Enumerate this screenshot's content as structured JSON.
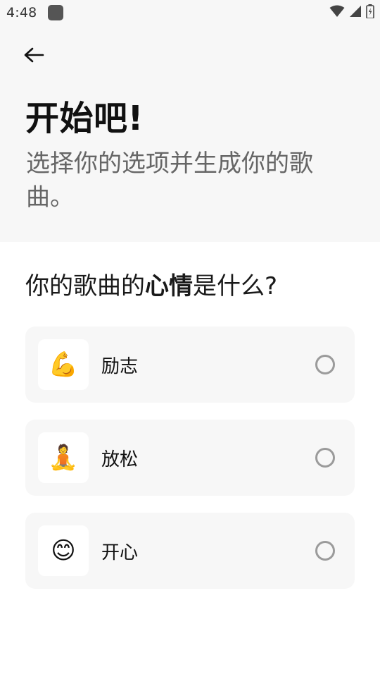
{
  "status_bar": {
    "time": "4:48",
    "icons": [
      "app-icon",
      "wifi-icon",
      "signal-icon",
      "battery-icon"
    ]
  },
  "header": {
    "back_icon": "arrow-left-icon",
    "title": "开始吧!",
    "subtitle": "选择你的选项并生成你的歌曲。"
  },
  "question": {
    "prefix": "你的歌曲的",
    "emphasis": "心情",
    "suffix": "是什么?"
  },
  "options": [
    {
      "emoji": "💪",
      "icon": "flexed-biceps-icon",
      "label": "励志",
      "selected": false
    },
    {
      "emoji": "🧘",
      "icon": "meditation-icon",
      "label": "放松",
      "selected": false
    },
    {
      "emoji": "😊",
      "icon": "smiling-face-icon",
      "label": "开心",
      "selected": false
    }
  ],
  "colors": {
    "top_background": "#f7f7f7",
    "card_background": "#f7f7f7",
    "radio_border": "#9b9b9b",
    "subtitle_text": "#666666"
  }
}
